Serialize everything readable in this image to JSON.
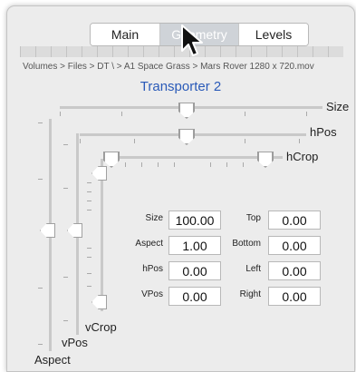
{
  "tabs": [
    "Main",
    "Geometry",
    "Levels"
  ],
  "breadcrumb": [
    "Volumes",
    "Files",
    "DT \\",
    "A1 Space Grass",
    "Mars Rover 1280 x 720.mov"
  ],
  "title": "Transporter 2",
  "sliders": {
    "size": "Size",
    "hpos": "hPos",
    "hcrop": "hCrop",
    "vcrop": "vCrop",
    "vpos": "vPos",
    "aspect": "Aspect"
  },
  "fields": {
    "size": {
      "label": "Size",
      "value": "100.00"
    },
    "aspect": {
      "label": "Aspect",
      "value": "1.00"
    },
    "hpos": {
      "label": "hPos",
      "value": "0.00"
    },
    "vpos": {
      "label": "VPos",
      "value": "0.00"
    },
    "top": {
      "label": "Top",
      "value": "0.00"
    },
    "bottom": {
      "label": "Bottom",
      "value": "0.00"
    },
    "left": {
      "label": "Left",
      "value": "0.00"
    },
    "right": {
      "label": "Right",
      "value": "0.00"
    }
  },
  "colors": {
    "accent": "#2a5ab8",
    "active_tab": "#cfd3d8"
  },
  "icons": {
    "cursor": "arrow-pointer-icon"
  }
}
